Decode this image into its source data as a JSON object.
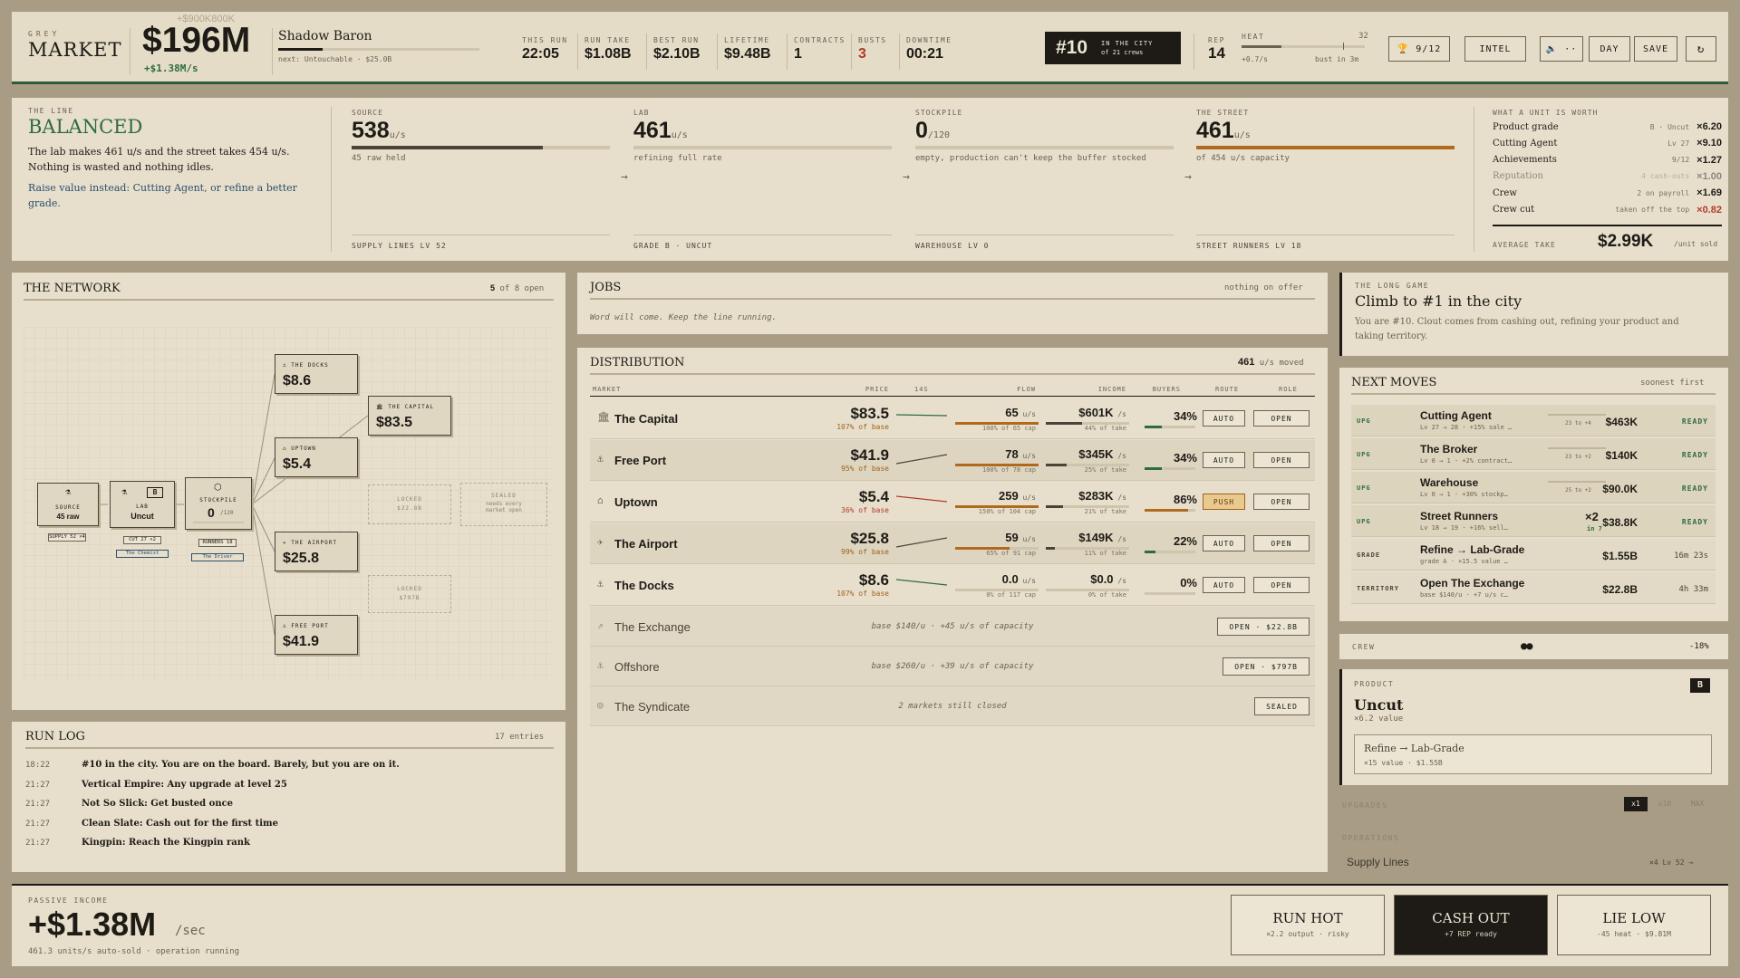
{
  "header": {
    "brand_small": "GREY",
    "brand_big": "MARKET",
    "cash_ghost": "+$900K800K",
    "cash": "$196M",
    "cash_rate": "+$1.38M/s",
    "player": "Shadow Baron",
    "next_rank": "next: Untouchable · $25.0B",
    "rank_progress": 0.22,
    "stats": [
      {
        "label": "THIS RUN",
        "value": "22:05"
      },
      {
        "label": "RUN TAKE",
        "value": "$1.08B"
      },
      {
        "label": "BEST RUN",
        "value": "$2.10B"
      },
      {
        "label": "LIFETIME",
        "value": "$9.48B"
      },
      {
        "label": "CONTRACTS",
        "value": "1"
      },
      {
        "label": "BUSTS",
        "value": "3"
      },
      {
        "label": "DOWNTIME",
        "value": "00:21"
      }
    ],
    "city_rank": "#10",
    "city_rank_l1": "IN THE CITY",
    "city_rank_l2": "of 21 crews",
    "rep_label": "REP",
    "rep": "14",
    "heat_label": "HEAT",
    "heat_value": "32",
    "heat_rate": "+0.7/s",
    "heat_bust": "bust in 3m",
    "heat_level": 0.32,
    "trophies": "9/12",
    "intel": "INTEL",
    "sound": "··",
    "day": "DAY",
    "save": "SAVE",
    "refresh": "↻"
  },
  "line": {
    "label": "THE LINE",
    "status": "BALANCED",
    "desc": "The lab makes 461 u/s and the street takes 454 u/s. Nothing is wasted and nothing idles.",
    "hint": "Raise value instead: Cutting Agent, or refine a better grade.",
    "cols": [
      {
        "label": "SOURCE",
        "value": "538",
        "unit": "u/s",
        "sub": "45 raw held",
        "foot": "SUPPLY LINES Lv 52",
        "fill": 0.74
      },
      {
        "label": "LAB",
        "value": "461",
        "unit": "u/s",
        "sub": "refining full rate",
        "foot": "GRADE B · UNCUT",
        "fill": 0
      },
      {
        "label": "STOCKPILE",
        "value": "0",
        "unit": "/120",
        "sub": "empty, production can't keep the buffer stocked",
        "foot": "WAREHOUSE Lv 0",
        "fill": 0
      },
      {
        "label": "THE STREET",
        "value": "461",
        "unit": "u/s",
        "sub": "of 454 u/s capacity",
        "foot": "STREET RUNNERS Lv 18",
        "fill": 1
      }
    ],
    "worth_label": "WHAT A UNIT IS WORTH",
    "worth": [
      {
        "name": "Product grade",
        "meta": "B · Uncut",
        "mult": "×6.20",
        "red": false,
        "dim": false
      },
      {
        "name": "Cutting Agent",
        "meta": "Lv 27",
        "mult": "×9.10",
        "red": false,
        "dim": false
      },
      {
        "name": "Achievements",
        "meta": "9/12",
        "mult": "×1.27",
        "red": false,
        "dim": false
      },
      {
        "name": "Reputation",
        "meta": "4 cash-outs",
        "mult": "×1.00",
        "red": false,
        "dim": true
      },
      {
        "name": "Crew",
        "meta": "2 on payroll",
        "mult": "×1.69",
        "red": false,
        "dim": false
      },
      {
        "name": "Crew cut",
        "meta": "taken off the top",
        "mult": "×0.82",
        "red": true,
        "dim": false
      }
    ],
    "avg_label": "AVERAGE TAKE",
    "avg": "$2.99K",
    "avg_unit": "/unit sold"
  },
  "network": {
    "title": "THE NETWORK",
    "open": "5",
    "open_of": "of 8 open",
    "source": {
      "name": "SOURCE",
      "val": "45 raw",
      "btn": "SUPPLY 52 ×4"
    },
    "lab": {
      "name": "LAB",
      "val": "Uncut",
      "grade": "B",
      "btn1": "CUT 27 ×2",
      "btn2": "The Chemist"
    },
    "stockpile": {
      "name": "STOCKPILE",
      "val": "0",
      "sub": "/120",
      "btn1": "RUNNERS 18",
      "btn2": "The Driver"
    },
    "markets": [
      {
        "name": "THE DOCKS",
        "price": "$8.6"
      },
      {
        "name": "THE CAPITAL",
        "price": "$83.5"
      },
      {
        "name": "UPTOWN",
        "price": "$5.4"
      },
      {
        "name": "THE AIRPORT",
        "price": "$25.8"
      },
      {
        "name": "FREE PORT",
        "price": "$41.9"
      }
    ],
    "locked1": {
      "l1": "LOCKED",
      "l2": "$22.8B"
    },
    "locked2": {
      "l1": "LOCKED",
      "l2": "$797B"
    },
    "sealed": {
      "l1": "SEALED",
      "l2": "needs every",
      "l3": "market open"
    }
  },
  "jobs": {
    "title": "JOBS",
    "status": "nothing on offer",
    "msg": "Word will come. Keep the line running."
  },
  "distribution": {
    "title": "DISTRIBUTION",
    "moved": "461",
    "moved_unit": "u/s moved",
    "cols": [
      "MARKET",
      "PRICE",
      "14S",
      "FLOW",
      "INCOME",
      "BUYERS",
      "ROUTE",
      "ROLE"
    ],
    "rows": [
      {
        "icon": "🏛",
        "name": "The Capital",
        "price": "$83.5",
        "base": "107% of base",
        "flow": "65",
        "flow_sub": "100% of 65 cap",
        "flow_fill": 1,
        "income": "$601K",
        "income_sub": "44% of take",
        "income_fill": 0.44,
        "buyers": "34%",
        "buyers_fill": 0.34,
        "route": "AUTO",
        "role": "OPEN",
        "trend": "flat",
        "low": false
      },
      {
        "icon": "⚓",
        "name": "Free Port",
        "price": "$41.9",
        "base": "95% of base",
        "flow": "78",
        "flow_sub": "100% of 78 cap",
        "flow_fill": 1,
        "income": "$345K",
        "income_sub": "25% of take",
        "income_fill": 0.25,
        "buyers": "34%",
        "buyers_fill": 0.34,
        "route": "AUTO",
        "role": "OPEN",
        "trend": "up",
        "low": false
      },
      {
        "icon": "⌂",
        "name": "Uptown",
        "price": "$5.4",
        "base": "36% of base",
        "flow": "259",
        "flow_sub": "150% of 104 cap",
        "flow_fill": 1,
        "income": "$283K",
        "income_sub": "21% of take",
        "income_fill": 0.21,
        "buyers": "86%",
        "buyers_fill": 0.86,
        "route": "PUSH",
        "role": "OPEN",
        "trend": "down",
        "low": true
      },
      {
        "icon": "✈",
        "name": "The Airport",
        "price": "$25.8",
        "base": "99% of base",
        "flow": "59",
        "flow_sub": "65% of 91 cap",
        "flow_fill": 0.65,
        "income": "$149K",
        "income_sub": "11% of take",
        "income_fill": 0.11,
        "buyers": "22%",
        "buyers_fill": 0.22,
        "route": "AUTO",
        "role": "OPEN",
        "trend": "up",
        "low": false
      },
      {
        "icon": "⚓",
        "name": "The Docks",
        "price": "$8.6",
        "base": "107% of base",
        "flow": "0.0",
        "flow_sub": "0% of 117 cap",
        "flow_fill": 0,
        "income": "$0.0",
        "income_sub": "0% of take",
        "income_fill": 0,
        "buyers": "0%",
        "buyers_fill": 0,
        "route": "AUTO",
        "role": "OPEN",
        "trend": "down",
        "low": false
      }
    ],
    "locked": [
      {
        "icon": "⇗",
        "name": "The Exchange",
        "desc": "base $140/u · +45 u/s of capacity",
        "btn": "OPEN · $22.8B"
      },
      {
        "icon": "⚓",
        "name": "Offshore",
        "desc": "base $260/u · +39 u/s of capacity",
        "btn": "OPEN · $797B"
      },
      {
        "icon": "◎",
        "name": "The Syndicate",
        "desc": "2 markets still closed",
        "btn": "SEALED"
      }
    ]
  },
  "log": {
    "title": "RUN LOG",
    "count": "17 entries",
    "entries": [
      {
        "t": "18:22",
        "m": "#10 in the city. You are on the board. Barely, but you are on it."
      },
      {
        "t": "21:27",
        "m": "Vertical Empire: Any upgrade at level 25"
      },
      {
        "t": "21:27",
        "m": "Not So Slick: Get busted once"
      },
      {
        "t": "21:27",
        "m": "Clean Slate: Cash out for the first time"
      },
      {
        "t": "21:27",
        "m": "Kingpin: Reach the Kingpin rank"
      }
    ]
  },
  "goal": {
    "label": "THE LONG GAME",
    "title": "Climb to #1 in the city",
    "desc": "You are #10. Clout comes from cashing out, refining your product and taking territory."
  },
  "next_moves": {
    "title": "NEXT MOVES",
    "sort": "soonest first",
    "rows": [
      {
        "tag": "UPG",
        "name": "Cutting Agent",
        "sub": "Lv 27 → 28 · +15% sale …",
        "mid": "23 to +4",
        "cost": "$463K",
        "status": "READY",
        "x2": "",
        "x2sub": ""
      },
      {
        "tag": "UPG",
        "name": "The Broker",
        "sub": "Lv 0 → 1 · +2% contract…",
        "mid": "23 to +2",
        "cost": "$140K",
        "status": "READY",
        "x2": "",
        "x2sub": ""
      },
      {
        "tag": "UPG",
        "name": "Warehouse",
        "sub": "Lv 0 → 1 · +30% stockp…",
        "mid": "25 to +2",
        "cost": "$90.0K",
        "status": "READY",
        "x2": "",
        "x2sub": ""
      },
      {
        "tag": "UPG",
        "name": "Street Runners",
        "sub": "Lv 18 → 19 · +16% sell…",
        "mid": "",
        "cost": "$38.8K",
        "status": "READY",
        "x2": "×2",
        "x2sub": "in 7"
      },
      {
        "tag": "GRADE",
        "name": "Refine → Lab-Grade",
        "sub": "grade A · ×15.5 value …",
        "mid": "",
        "cost": "$1.55B",
        "status": "16m 23s",
        "x2": "",
        "x2sub": ""
      },
      {
        "tag": "TERRITORY",
        "name": "Open The Exchange",
        "sub": "base $140/u · +7 u/s c…",
        "mid": "",
        "cost": "$22.8B",
        "status": "4h 33m",
        "x2": "",
        "x2sub": ""
      }
    ]
  },
  "crew": {
    "label": "CREW",
    "dots": "●●",
    "cut": "-18%"
  },
  "product": {
    "label": "PRODUCT",
    "grade": "B",
    "name": "Uncut",
    "value": "×6.2 value",
    "refine": "Refine → Lab-Grade",
    "refine_sub": "×15 value · $1.55B"
  },
  "upgrades": {
    "label": "UPGRADES",
    "x1": "x1",
    "x10": "x10",
    "max": "MAX",
    "ops": "OPERATIONS",
    "item": "Supply Lines",
    "item_meta": "×4  Lv 52 →"
  },
  "footer": {
    "label": "PASSIVE INCOME",
    "amount": "+$1.38M",
    "unit": "/sec",
    "sub": "461.3 units/s auto-sold · operation running",
    "btns": [
      {
        "t": "RUN HOT",
        "s": "×2.2 output · risky"
      },
      {
        "t": "CASH OUT",
        "s": "+7 REP ready"
      },
      {
        "t": "LIE LOW",
        "s": "-45 heat · $9.81M"
      }
    ]
  }
}
